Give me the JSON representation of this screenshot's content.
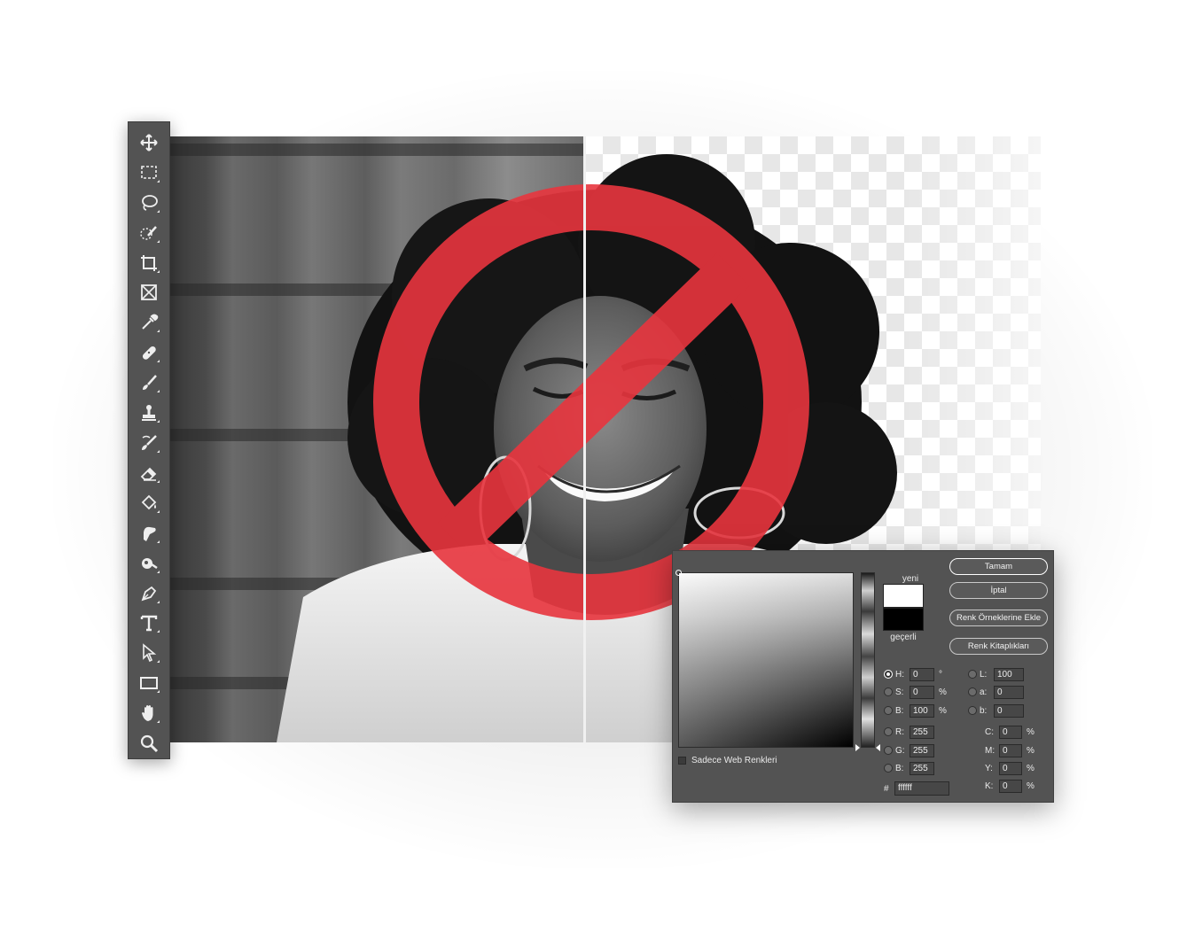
{
  "toolbar": {
    "tools": [
      {
        "name": "move-tool",
        "icon": "move-icon"
      },
      {
        "name": "rectangular-marquee-tool",
        "icon": "marquee-icon"
      },
      {
        "name": "lasso-tool",
        "icon": "lasso-icon"
      },
      {
        "name": "quick-selection-tool",
        "icon": "quick-selection-icon"
      },
      {
        "name": "crop-tool",
        "icon": "crop-icon"
      },
      {
        "name": "frame-tool",
        "icon": "frame-icon"
      },
      {
        "name": "eyedropper-tool",
        "icon": "eyedropper-icon"
      },
      {
        "name": "spot-healing-tool",
        "icon": "bandage-icon"
      },
      {
        "name": "brush-tool",
        "icon": "brush-icon"
      },
      {
        "name": "clone-stamp-tool",
        "icon": "stamp-icon"
      },
      {
        "name": "history-brush-tool",
        "icon": "history-brush-icon"
      },
      {
        "name": "eraser-tool",
        "icon": "eraser-icon"
      },
      {
        "name": "paint-bucket-tool",
        "icon": "paint-bucket-icon"
      },
      {
        "name": "smudge-tool",
        "icon": "smudge-icon"
      },
      {
        "name": "dodge-tool",
        "icon": "dodge-icon"
      },
      {
        "name": "pen-tool",
        "icon": "pen-icon"
      },
      {
        "name": "type-tool",
        "icon": "type-icon"
      },
      {
        "name": "path-selection-tool",
        "icon": "arrow-icon"
      },
      {
        "name": "rectangle-tool",
        "icon": "rectangle-icon"
      },
      {
        "name": "hand-tool",
        "icon": "hand-icon"
      },
      {
        "name": "zoom-tool",
        "icon": "zoom-icon"
      }
    ]
  },
  "overlay": {
    "icon": "prohibition-icon",
    "color": "#e8353e"
  },
  "picker": {
    "new_label": "yeni",
    "current_label": "geçerli",
    "new_color": "#ffffff",
    "current_color": "#000000",
    "web_only_label": "Sadece Web Renkleri",
    "buttons": {
      "ok": "Tamam",
      "cancel": "İptal",
      "add_swatch": "Renk Örneklerine Ekle",
      "libraries": "Renk Kitaplıkları"
    },
    "hsb": [
      {
        "key": "H:",
        "value": "0",
        "unit": "°",
        "selected": true
      },
      {
        "key": "S:",
        "value": "0",
        "unit": "%",
        "selected": false
      },
      {
        "key": "B:",
        "value": "100",
        "unit": "%",
        "selected": false
      }
    ],
    "rgb": [
      {
        "key": "R:",
        "value": "255"
      },
      {
        "key": "G:",
        "value": "255"
      },
      {
        "key": "B:",
        "value": "255"
      }
    ],
    "lab": [
      {
        "key": "L:",
        "value": "100"
      },
      {
        "key": "a:",
        "value": "0"
      },
      {
        "key": "b:",
        "value": "0"
      }
    ],
    "cmyk": [
      {
        "key": "C:",
        "value": "0",
        "unit": "%"
      },
      {
        "key": "M:",
        "value": "0",
        "unit": "%"
      },
      {
        "key": "Y:",
        "value": "0",
        "unit": "%"
      },
      {
        "key": "K:",
        "value": "0",
        "unit": "%"
      }
    ],
    "hex_label": "#",
    "hex_value": "ffffff"
  }
}
